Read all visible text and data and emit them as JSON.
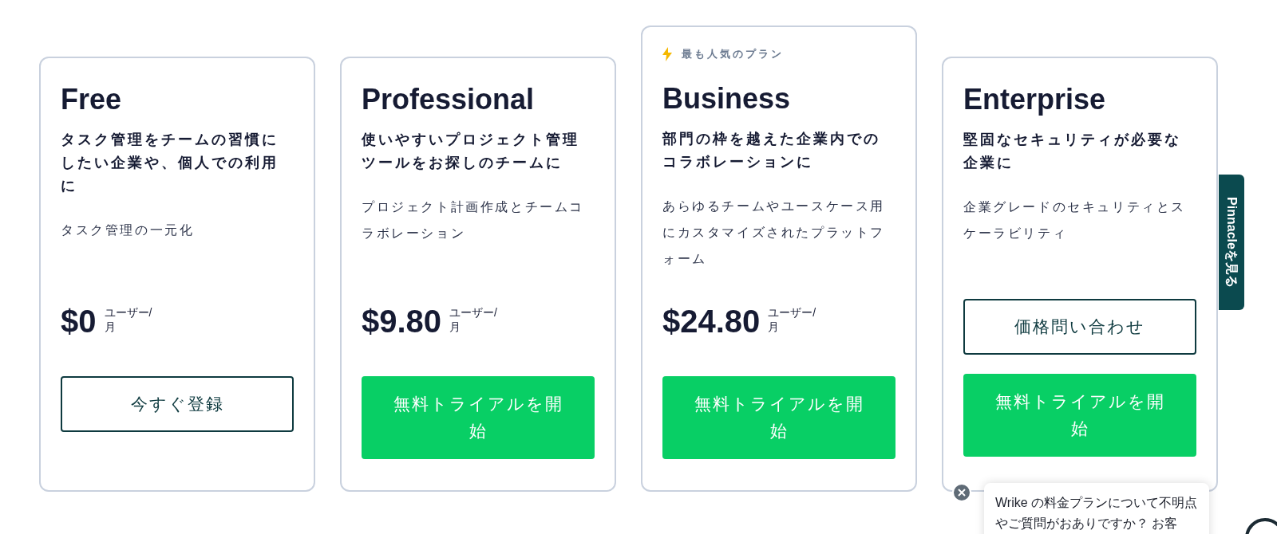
{
  "plans": [
    {
      "name": "Free",
      "popular": false,
      "subtitle": "タスク管理をチームの習慣にしたい企業や、個人での利用に",
      "description": "タスク管理の一元化",
      "price": "$0",
      "unit": "ユーザー/月",
      "buttons": [
        {
          "kind": "outline",
          "label": "今すぐ登録"
        }
      ]
    },
    {
      "name": "Professional",
      "popular": false,
      "subtitle": "使いやすいプロジェクト管理ツールをお探しのチームに",
      "description": "プロジェクト計画作成とチームコラボレーション",
      "price": "$9.80",
      "unit": "ユーザー/月",
      "buttons": [
        {
          "kind": "primary",
          "label": "無料トライアルを開始"
        }
      ]
    },
    {
      "name": "Business",
      "popular": true,
      "badge": "最も人気のプラン",
      "subtitle": "部門の枠を越えた企業内でのコラボレーションに",
      "description": "あらゆるチームやユースケース用にカスタマイズされたプラットフォーム",
      "price": "$24.80",
      "unit": "ユーザー/月",
      "buttons": [
        {
          "kind": "primary",
          "label": "無料トライアルを開始"
        }
      ]
    },
    {
      "name": "Enterprise",
      "popular": false,
      "subtitle": "堅固なセキュリティが必要な企業に",
      "description": "企業グレードのセキュリティとスケーラビリティ",
      "buttons": [
        {
          "kind": "outline",
          "label": "価格問い合わせ"
        },
        {
          "kind": "primary",
          "label": "無料トライアルを開始"
        }
      ]
    }
  ],
  "side_tab": "Pinnacleを見る",
  "chat_popup": {
    "message": "Wrike の料金プランについて不明点やご質問がおありですか？ お客"
  }
}
